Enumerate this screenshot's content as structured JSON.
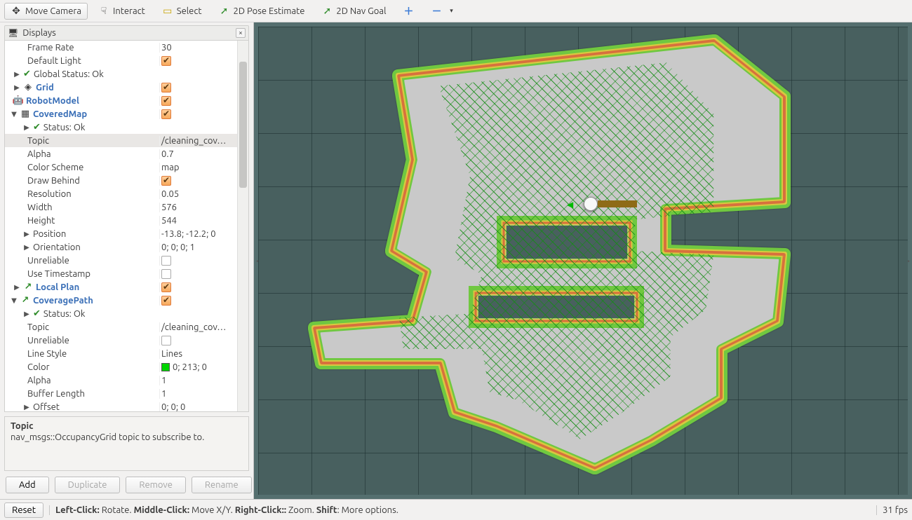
{
  "toolbar": {
    "move_camera": "Move Camera",
    "interact": "Interact",
    "select": "Select",
    "pose_estimate": "2D Pose Estimate",
    "nav_goal": "2D Nav Goal"
  },
  "panel": {
    "title": "Displays"
  },
  "tree": [
    {
      "indent": 24,
      "name": "Frame Rate",
      "value": "30"
    },
    {
      "indent": 24,
      "name": "Default Light",
      "check": true
    },
    {
      "indent": 4,
      "arrow": "▶",
      "ok": true,
      "name": "Global Status: Ok"
    },
    {
      "indent": 4,
      "arrow": "▶",
      "icon": "grid",
      "bold": true,
      "name": "Grid",
      "check": true
    },
    {
      "indent": 4,
      "icon": "robot",
      "bold": true,
      "name": "RobotModel",
      "check": true
    },
    {
      "indent": 0,
      "arrow": "▼",
      "icon": "map",
      "bold": true,
      "name": "CoveredMap",
      "check": true
    },
    {
      "indent": 18,
      "arrow": "▶",
      "ok": true,
      "name": "Status: Ok"
    },
    {
      "indent": 24,
      "name": "Topic",
      "value": "/cleaning_cov…",
      "selected": true
    },
    {
      "indent": 24,
      "name": "Alpha",
      "value": "0.7"
    },
    {
      "indent": 24,
      "name": "Color Scheme",
      "value": "map"
    },
    {
      "indent": 24,
      "name": "Draw Behind",
      "check": true
    },
    {
      "indent": 24,
      "name": "Resolution",
      "value": "0.05"
    },
    {
      "indent": 24,
      "name": "Width",
      "value": "576"
    },
    {
      "indent": 24,
      "name": "Height",
      "value": "544"
    },
    {
      "indent": 18,
      "arrow": "▶",
      "name": "Position",
      "value": "-13.8; -12.2; 0"
    },
    {
      "indent": 18,
      "arrow": "▶",
      "name": "Orientation",
      "value": "0; 0; 0; 1"
    },
    {
      "indent": 24,
      "name": "Unreliable",
      "check": false
    },
    {
      "indent": 24,
      "name": "Use Timestamp",
      "check": false
    },
    {
      "indent": 4,
      "arrow": "▶",
      "icon": "path",
      "bold": true,
      "name": "Local Plan",
      "check": true
    },
    {
      "indent": 0,
      "arrow": "▼",
      "icon": "path",
      "bold": true,
      "name": "CoveragePath",
      "check": true
    },
    {
      "indent": 18,
      "arrow": "▶",
      "ok": true,
      "name": "Status: Ok"
    },
    {
      "indent": 24,
      "name": "Topic",
      "value": "/cleaning_cov…"
    },
    {
      "indent": 24,
      "name": "Unreliable",
      "check": false
    },
    {
      "indent": 24,
      "name": "Line Style",
      "value": "Lines"
    },
    {
      "indent": 24,
      "name": "Color",
      "swatch": true,
      "value": "0; 213; 0"
    },
    {
      "indent": 24,
      "name": "Alpha",
      "value": "1"
    },
    {
      "indent": 24,
      "name": "Buffer Length",
      "value": "1"
    },
    {
      "indent": 18,
      "arrow": "▶",
      "name": "Offset",
      "value": "0; 0; 0"
    }
  ],
  "description": {
    "title": "Topic",
    "body": "nav_msgs::OccupancyGrid topic to subscribe to."
  },
  "buttons": {
    "add": "Add",
    "duplicate": "Duplicate",
    "remove": "Remove",
    "rename": "Rename"
  },
  "footer": {
    "reset": "Reset",
    "hint_left": "Left-Click:",
    "hint_left_t": " Rotate. ",
    "hint_mid": "Middle-Click:",
    "hint_mid_t": " Move X/Y. ",
    "hint_right": "Right-Click::",
    "hint_right_t": " Zoom. ",
    "hint_shift": "Shift",
    "hint_shift_t": ": More options.",
    "fps": "31 fps"
  }
}
